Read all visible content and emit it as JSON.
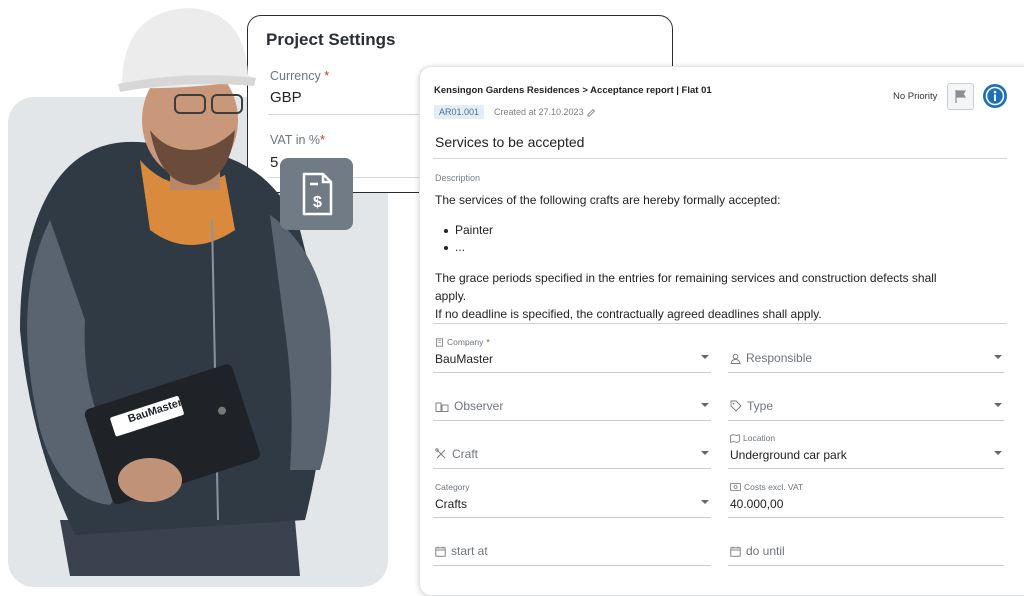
{
  "project_settings": {
    "title": "Project Settings",
    "currency_label": "Currency",
    "currency_value": "GBP",
    "vat_label": "VAT in %",
    "vat_value": "5",
    "required_mark": "*"
  },
  "icon_tile": {
    "icon": "invoice-dollar-icon"
  },
  "worker": {
    "tablet_brand": "BauMaster"
  },
  "report": {
    "breadcrumb": "Kensingon Gardens Residences > Acceptance report | Flat 01",
    "id": "AR01.001",
    "created": "Created at 27.10.2023",
    "priority": "No Priority",
    "title": "Services to be accepted",
    "description_label": "Description",
    "description_intro": "The services of the following crafts are hereby formally accepted:",
    "bullets": [
      "Painter",
      "..."
    ],
    "description_p1": "The grace periods specified in the entries for remaining services and construction defects shall",
    "description_p1b": "apply.",
    "description_p2": "If no deadline is specified, the contractually agreed deadlines shall apply.",
    "fields": {
      "company": {
        "label": "Company",
        "required": "*",
        "value": "BauMaster"
      },
      "responsible": {
        "placeholder": "Responsible"
      },
      "observer": {
        "placeholder": "Observer"
      },
      "type": {
        "placeholder": "Type"
      },
      "craft": {
        "placeholder": "Craft"
      },
      "location": {
        "label": "Location",
        "value": "Underground car park"
      },
      "category": {
        "label": "Category",
        "value": "Crafts"
      },
      "costs": {
        "label": "Costs excl. VAT",
        "value": "40.000,00"
      },
      "start": {
        "placeholder": "start at"
      },
      "until": {
        "placeholder": "do until"
      }
    }
  },
  "colors": {
    "accent": "#1d6fb8",
    "required": "#c0392b",
    "badge_bg": "#e4edf6"
  }
}
